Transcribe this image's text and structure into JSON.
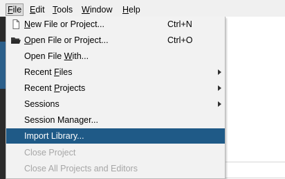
{
  "menubar": {
    "items": [
      {
        "mnemonic": "F",
        "rest": "ile"
      },
      {
        "mnemonic": "E",
        "rest": "dit"
      },
      {
        "mnemonic": "T",
        "rest": "ools"
      },
      {
        "mnemonic": "W",
        "rest": "indow"
      },
      {
        "mnemonic": "H",
        "rest": "elp"
      }
    ]
  },
  "file_menu": {
    "new_file_or_project": {
      "mnemonic": "N",
      "rest": "ew File or Project...",
      "shortcut": "Ctrl+N",
      "icon": "new-file-icon"
    },
    "open_file_or_project": {
      "mnemonic": "O",
      "rest": "pen File or Project...",
      "shortcut": "Ctrl+O",
      "icon": "open-folder-icon"
    },
    "open_file_with": {
      "pre": "Open File ",
      "mnemonic": "W",
      "rest": "ith..."
    },
    "recent_files": {
      "pre": "Recent ",
      "mnemonic": "F",
      "rest": "iles"
    },
    "recent_projects": {
      "pre": "Recent ",
      "mnemonic": "P",
      "rest": "rojects"
    },
    "sessions": {
      "label": "Sessions"
    },
    "session_manager": {
      "label": "Session Manager..."
    },
    "import_library": {
      "label": "Import Library..."
    },
    "close_project": {
      "label": "Close Project"
    },
    "close_all": {
      "label": "Close All Projects and Editors"
    }
  },
  "colors": {
    "highlight": "#1f5a87",
    "disabled_text": "#a6a6a6",
    "menu_bg": "#f2f2f2"
  }
}
